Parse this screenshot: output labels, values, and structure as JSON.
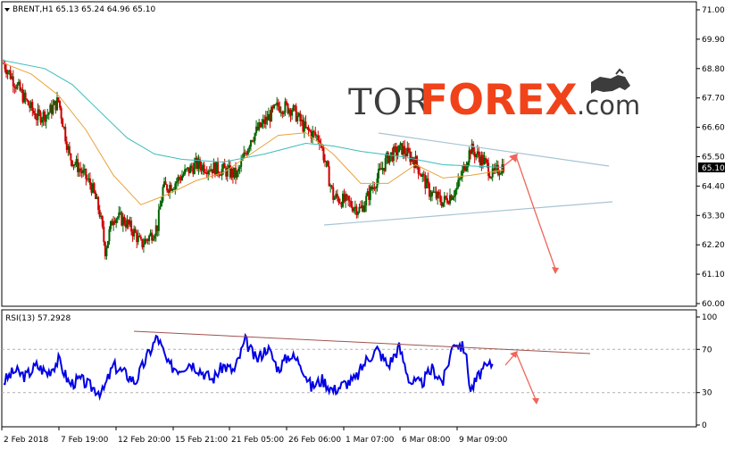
{
  "window": {
    "symbol_header": "BRENT,H1  65.13 65.24 64.96 65.10",
    "rsi_header": "RSI(13) 57.2928",
    "current_price_label": "65.10"
  },
  "watermark": {
    "part1": "TOR",
    "part2": "FOREX",
    "part3": ".com"
  },
  "price_axis": {
    "labels": [
      "71.00",
      "69.90",
      "68.80",
      "67.70",
      "66.60",
      "65.50",
      "64.40",
      "63.30",
      "62.20",
      "61.10",
      "60.00"
    ],
    "min": 60.0,
    "max": 71.0
  },
  "rsi_axis": {
    "labels": [
      "100",
      "70",
      "30",
      "0"
    ],
    "levels": [
      70,
      30
    ]
  },
  "time_axis": {
    "labels": [
      "2 Feb 2018",
      "7 Feb 19:00",
      "12 Feb 20:00",
      "15 Feb 21:00",
      "21 Feb 05:00",
      "26 Feb 06:00",
      "1 Mar 07:00",
      "6 Mar 08:00",
      "9 Mar 09:00"
    ]
  },
  "colors": {
    "bull_candle": "#006400",
    "bear_candle": "#cc0000",
    "ma_fast": "#e8a33a",
    "ma_slow": "#3cbcbc",
    "rsi_line": "#0000e6",
    "trendline": "#a7c4d4",
    "rsi_trendline": "#a0524d",
    "projection_arrow": "#f0665a",
    "price_box": "#000000"
  },
  "chart_data": {
    "type": "line",
    "price_path": [
      [
        0,
        69.0
      ],
      [
        4,
        68.3
      ],
      [
        8,
        67.6
      ],
      [
        12,
        67.0
      ],
      [
        16,
        67.1
      ],
      [
        20,
        67.6
      ],
      [
        24,
        65.5
      ],
      [
        28,
        65.0
      ],
      [
        32,
        64.4
      ],
      [
        35,
        63.4
      ],
      [
        37,
        62.0
      ],
      [
        40,
        63.3
      ],
      [
        44,
        63.1
      ],
      [
        48,
        62.6
      ],
      [
        50,
        62.2
      ],
      [
        53,
        62.5
      ],
      [
        56,
        62.9
      ],
      [
        58,
        64.3
      ],
      [
        62,
        64.5
      ],
      [
        65,
        64.8
      ],
      [
        70,
        65.2
      ],
      [
        75,
        65.1
      ],
      [
        80,
        65.0
      ],
      [
        85,
        64.8
      ],
      [
        90,
        66.2
      ],
      [
        95,
        66.8
      ],
      [
        100,
        67.4
      ],
      [
        105,
        67.3
      ],
      [
        110,
        66.5
      ],
      [
        115,
        66.2
      ],
      [
        120,
        64.0
      ],
      [
        125,
        63.8
      ],
      [
        130,
        63.5
      ],
      [
        135,
        64.5
      ],
      [
        140,
        65.5
      ],
      [
        145,
        65.8
      ],
      [
        150,
        65.3
      ],
      [
        155,
        64.2
      ],
      [
        160,
        63.8
      ],
      [
        165,
        64.3
      ],
      [
        170,
        65.8
      ],
      [
        175,
        65.3
      ],
      [
        178,
        64.8
      ],
      [
        182,
        65.2
      ]
    ],
    "ma_fast_path": [
      [
        0,
        69.0
      ],
      [
        10,
        68.6
      ],
      [
        20,
        67.8
      ],
      [
        30,
        66.5
      ],
      [
        40,
        64.8
      ],
      [
        50,
        63.7
      ],
      [
        60,
        64.1
      ],
      [
        70,
        64.6
      ],
      [
        80,
        64.9
      ],
      [
        90,
        65.6
      ],
      [
        100,
        66.3
      ],
      [
        110,
        66.4
      ],
      [
        120,
        65.6
      ],
      [
        130,
        64.5
      ],
      [
        140,
        64.5
      ],
      [
        150,
        65.2
      ],
      [
        160,
        64.7
      ],
      [
        170,
        64.8
      ],
      [
        182,
        65.0
      ]
    ],
    "ma_slow_path": [
      [
        0,
        69.1
      ],
      [
        15,
        68.8
      ],
      [
        25,
        68.2
      ],
      [
        35,
        67.2
      ],
      [
        45,
        66.2
      ],
      [
        55,
        65.6
      ],
      [
        65,
        65.4
      ],
      [
        80,
        65.3
      ],
      [
        95,
        65.6
      ],
      [
        110,
        66.0
      ],
      [
        120,
        65.9
      ],
      [
        130,
        65.7
      ],
      [
        145,
        65.5
      ],
      [
        160,
        65.2
      ],
      [
        182,
        65.1
      ]
    ],
    "rsi_path": [
      [
        0,
        40
      ],
      [
        4,
        50
      ],
      [
        8,
        45
      ],
      [
        12,
        55
      ],
      [
        16,
        48
      ],
      [
        20,
        60
      ],
      [
        24,
        38
      ],
      [
        28,
        42
      ],
      [
        32,
        35
      ],
      [
        36,
        30
      ],
      [
        40,
        55
      ],
      [
        44,
        48
      ],
      [
        48,
        40
      ],
      [
        52,
        62
      ],
      [
        56,
        82
      ],
      [
        60,
        55
      ],
      [
        64,
        52
      ],
      [
        68,
        58
      ],
      [
        72,
        50
      ],
      [
        76,
        42
      ],
      [
        80,
        55
      ],
      [
        84,
        50
      ],
      [
        88,
        78
      ],
      [
        92,
        60
      ],
      [
        96,
        72
      ],
      [
        100,
        52
      ],
      [
        104,
        65
      ],
      [
        108,
        58
      ],
      [
        112,
        35
      ],
      [
        116,
        42
      ],
      [
        120,
        32
      ],
      [
        124,
        38
      ],
      [
        128,
        42
      ],
      [
        132,
        60
      ],
      [
        136,
        70
      ],
      [
        140,
        55
      ],
      [
        144,
        72
      ],
      [
        148,
        40
      ],
      [
        152,
        38
      ],
      [
        156,
        52
      ],
      [
        160,
        40
      ],
      [
        164,
        78
      ],
      [
        168,
        70
      ],
      [
        170,
        32
      ],
      [
        174,
        50
      ],
      [
        178,
        57
      ]
    ],
    "x_range": [
      0,
      182
    ]
  }
}
